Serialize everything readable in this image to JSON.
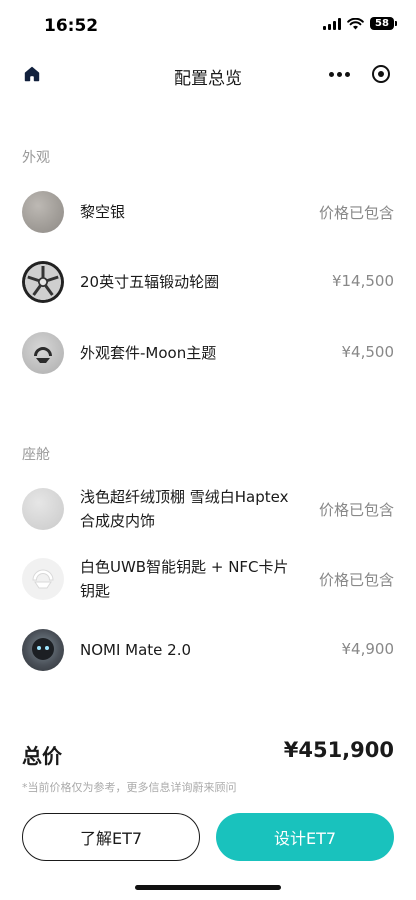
{
  "status_bar": {
    "time": "16:52",
    "battery": "58"
  },
  "nav": {
    "title": "配置总览"
  },
  "sections": [
    {
      "label": "外观",
      "items": [
        {
          "name": "黎空银",
          "price": "价格已包含",
          "swatch": "silver-paint"
        },
        {
          "name": "20英寸五辐锻动轮圈",
          "price": "¥14,500",
          "swatch": "wheel"
        },
        {
          "name": "外观套件-Moon主题",
          "price": "¥4,500",
          "swatch": "moon-kit"
        }
      ]
    },
    {
      "label": "座舱",
      "items": [
        {
          "name": "浅色超纤绒顶棚 雪绒白Haptex合成皮内饰",
          "price": "价格已包含",
          "swatch": "interior"
        },
        {
          "name": "白色UWB智能钥匙 + NFC卡片钥匙",
          "price": "价格已包含",
          "swatch": "key"
        },
        {
          "name": "NOMI Mate 2.0",
          "price": "¥4,900",
          "swatch": "nomi"
        }
      ]
    }
  ],
  "total": {
    "label": "总价",
    "value": "¥451,900"
  },
  "disclaimer": "*当前价格仅为参考，更多信息详询蔚来顾问",
  "buttons": {
    "learn": "了解ET7",
    "design": "设计ET7"
  },
  "colors": {
    "accent": "#19c2bd",
    "text": "#1a1a1a",
    "muted": "#888888"
  }
}
